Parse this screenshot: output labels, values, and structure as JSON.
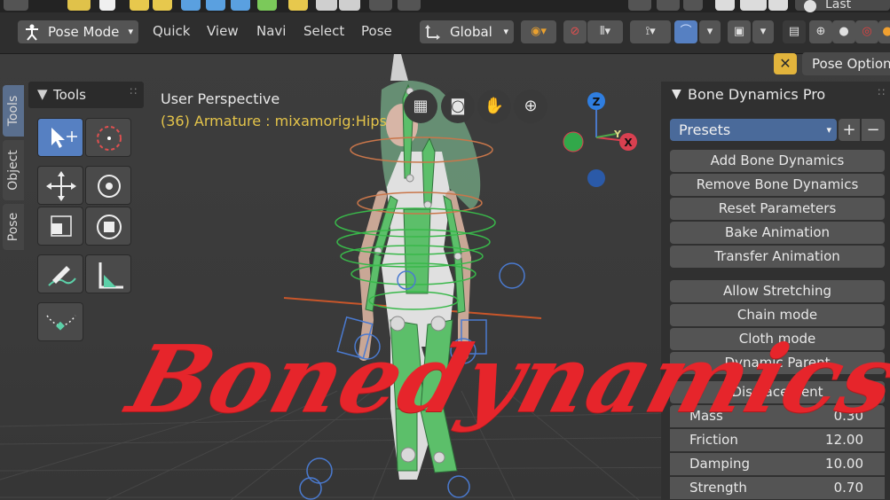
{
  "header": {
    "mode": "Pose Mode",
    "menus": [
      "Quick",
      "View",
      "Navi",
      "Select",
      "Pose"
    ],
    "orientation": "Global"
  },
  "topbar": {
    "last_label": "Last"
  },
  "left_tabs": [
    "Tools",
    "Object",
    "Pose"
  ],
  "tools": {
    "title": "Tools"
  },
  "viewport": {
    "perspective": "User Perspective",
    "object_info": "(36) Armature : mixamorig:Hips",
    "axis_labels": [
      "Z",
      "Y",
      "X"
    ]
  },
  "pose_options_label": "Pose Options",
  "panel": {
    "title": "Bone Dynamics Pro",
    "presets": "Presets",
    "actions": [
      "Add Bone Dynamics",
      "Remove Bone Dynamics",
      "Reset Parameters",
      "Bake Animation",
      "Transfer Animation"
    ],
    "modes": [
      "Allow Stretching",
      "Chain mode",
      "Cloth mode",
      "Dynamic Parent"
    ],
    "section": "Displacement",
    "props": [
      {
        "label": "Mass",
        "value": "0.30"
      },
      {
        "label": "Friction",
        "value": "12.00"
      },
      {
        "label": "Damping",
        "value": "10.00"
      },
      {
        "label": "Strength",
        "value": "0.70"
      }
    ]
  },
  "watermark": "Bonedynamics",
  "colors": {
    "accent": "#5680c2",
    "info_text": "#e4c44a",
    "watermark": "#e6252b",
    "bone_green": "#5cbf6a"
  }
}
